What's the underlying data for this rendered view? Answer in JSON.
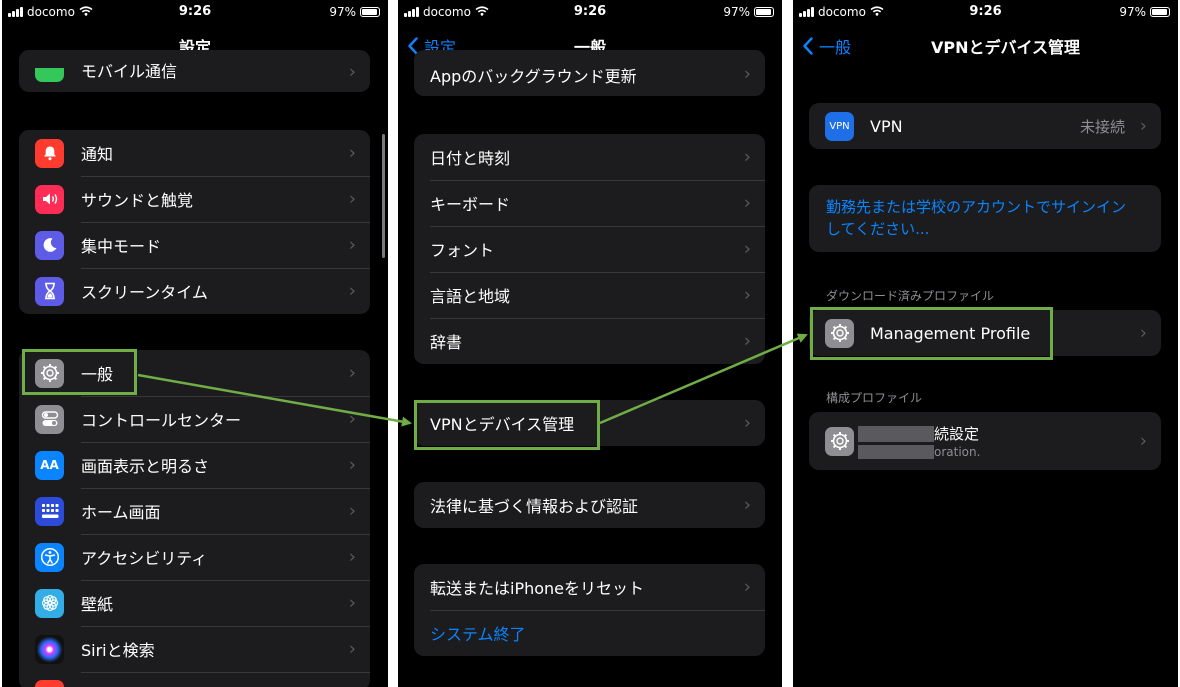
{
  "status": {
    "carrier": "docomo",
    "time": "9:26",
    "battery": "97%"
  },
  "screen1": {
    "title": "設定",
    "partial_row": "モバイル通信",
    "group1": [
      {
        "label": "通知",
        "icon": "bell-icon",
        "color": "#ff3b30"
      },
      {
        "label": "サウンドと触覚",
        "icon": "speaker-icon",
        "color": "#ff2d55"
      },
      {
        "label": "集中モード",
        "icon": "moon-icon",
        "color": "#5e5ce6"
      },
      {
        "label": "スクリーンタイム",
        "icon": "hourglass-icon",
        "color": "#5e5ce6"
      }
    ],
    "group2": [
      {
        "label": "一般",
        "icon": "gear-icon",
        "color": "#8e8e93"
      },
      {
        "label": "コントロールセンター",
        "icon": "toggle-icon",
        "color": "#8e8e93"
      },
      {
        "label": "画面表示と明るさ",
        "icon": "text-size-icon",
        "color": "#0a84ff",
        "glyph": "AA"
      },
      {
        "label": "ホーム画面",
        "icon": "grid-icon",
        "color": "#2c4bd8"
      },
      {
        "label": "アクセシビリティ",
        "icon": "accessibility-icon",
        "color": "#0a84ff"
      },
      {
        "label": "壁紙",
        "icon": "flower-icon",
        "color": "#32ade6"
      },
      {
        "label": "Siriと検索",
        "icon": "siri-icon",
        "color": "#222"
      }
    ]
  },
  "screen2": {
    "back": "設定",
    "title": "一般",
    "partial_row": "Appのバックグラウンド更新",
    "group1": [
      "日付と時刻",
      "キーボード",
      "フォント",
      "言語と地域",
      "辞書"
    ],
    "vpn_row": "VPNとデバイス管理",
    "legal_row": "法律に基づく情報および認証",
    "reset_row": "転送またはiPhoneをリセット",
    "shutdown_row": "システム終了"
  },
  "screen3": {
    "back": "一般",
    "title": "VPNとデバイス管理",
    "vpn": {
      "label": "VPN",
      "icon_text": "VPN",
      "status": "未接続"
    },
    "signin": "勤務先または学校のアカウントでサインインしてください...",
    "downloaded_header": "ダウンロード済みプロファイル",
    "management_profile": "Management Profile",
    "config_header": "構成プロファイル",
    "config_title_visible": "続設定",
    "config_subtitle_visible": "oration."
  }
}
